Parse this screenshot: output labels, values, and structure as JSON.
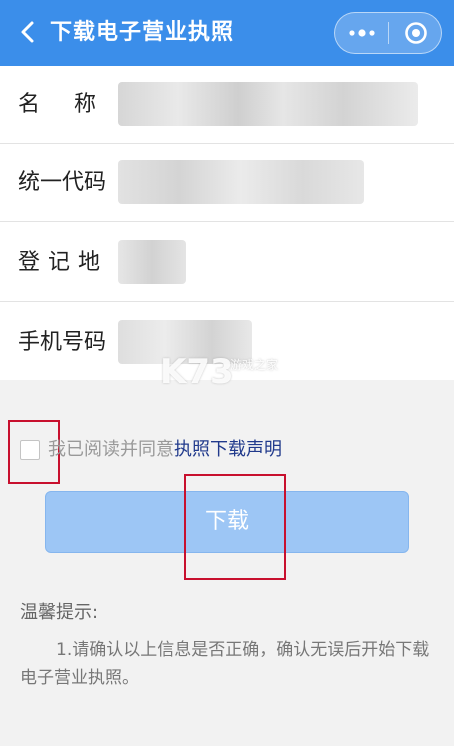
{
  "header": {
    "title": "下载电子营业执照",
    "back_icon": "chevron-left-icon",
    "more_icon": "more-dots-icon",
    "close_icon": "target-close-icon",
    "bg_color": "#3b8eea"
  },
  "form": {
    "fields": [
      {
        "label": "名称",
        "value_blurred": true
      },
      {
        "label": "统一代码",
        "value_blurred": true
      },
      {
        "label": "登记地",
        "value_blurred": true
      },
      {
        "label": "手机号码",
        "value_blurred": true
      }
    ]
  },
  "watermark": {
    "text": "K73",
    "sub": "游戏之家"
  },
  "agreement": {
    "text": "我已阅读并同意",
    "link": "执照下载声明",
    "checked": false
  },
  "download_button": {
    "label": "下载",
    "color": "#9dc6f5"
  },
  "tips": {
    "title": "温馨提示:",
    "body": "1.请确认以上信息是否正确，确认无误后开始下载电子营业执照。"
  },
  "annotation_color": "#c8102e"
}
